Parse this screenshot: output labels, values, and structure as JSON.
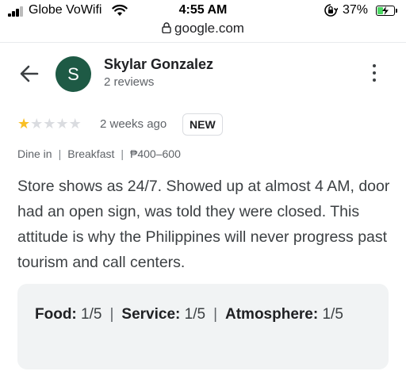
{
  "status_bar": {
    "carrier": "Globe VoWifi",
    "time": "4:55 AM",
    "battery_percent": "37%",
    "battery_level": 0.37,
    "battery_color": "#4cd964"
  },
  "browser": {
    "url": "google.com"
  },
  "reviewer": {
    "avatar_initial": "S",
    "avatar_color": "#1e5a45",
    "name": "Skylar Gonzalez",
    "review_count": "2 reviews"
  },
  "review": {
    "rating": 1,
    "rating_max": 5,
    "star_color": "#f9bf24",
    "age": "2 weeks ago",
    "badge": "NEW",
    "meta": [
      "Dine in",
      "Breakfast",
      "₱400–600"
    ],
    "meta_separator": "|",
    "text": "Store shows as 24/7. Showed up at almost 4 AM, door had an open sign, was told they were closed. This attitude is why the Philippines will never progress past tourism and call centers."
  },
  "sub_ratings": {
    "separator": "|",
    "items": [
      {
        "label": "Food:",
        "value": "1/5"
      },
      {
        "label": "Service:",
        "value": "1/5"
      },
      {
        "label": "Atmosphere:",
        "value": "1/5"
      }
    ]
  },
  "icons": [
    "signal-icon",
    "wifi-icon",
    "orientation-lock-icon",
    "battery-icon",
    "charging-icon",
    "lock-icon",
    "back-arrow-icon",
    "more-options-icon",
    "star-icon"
  ]
}
